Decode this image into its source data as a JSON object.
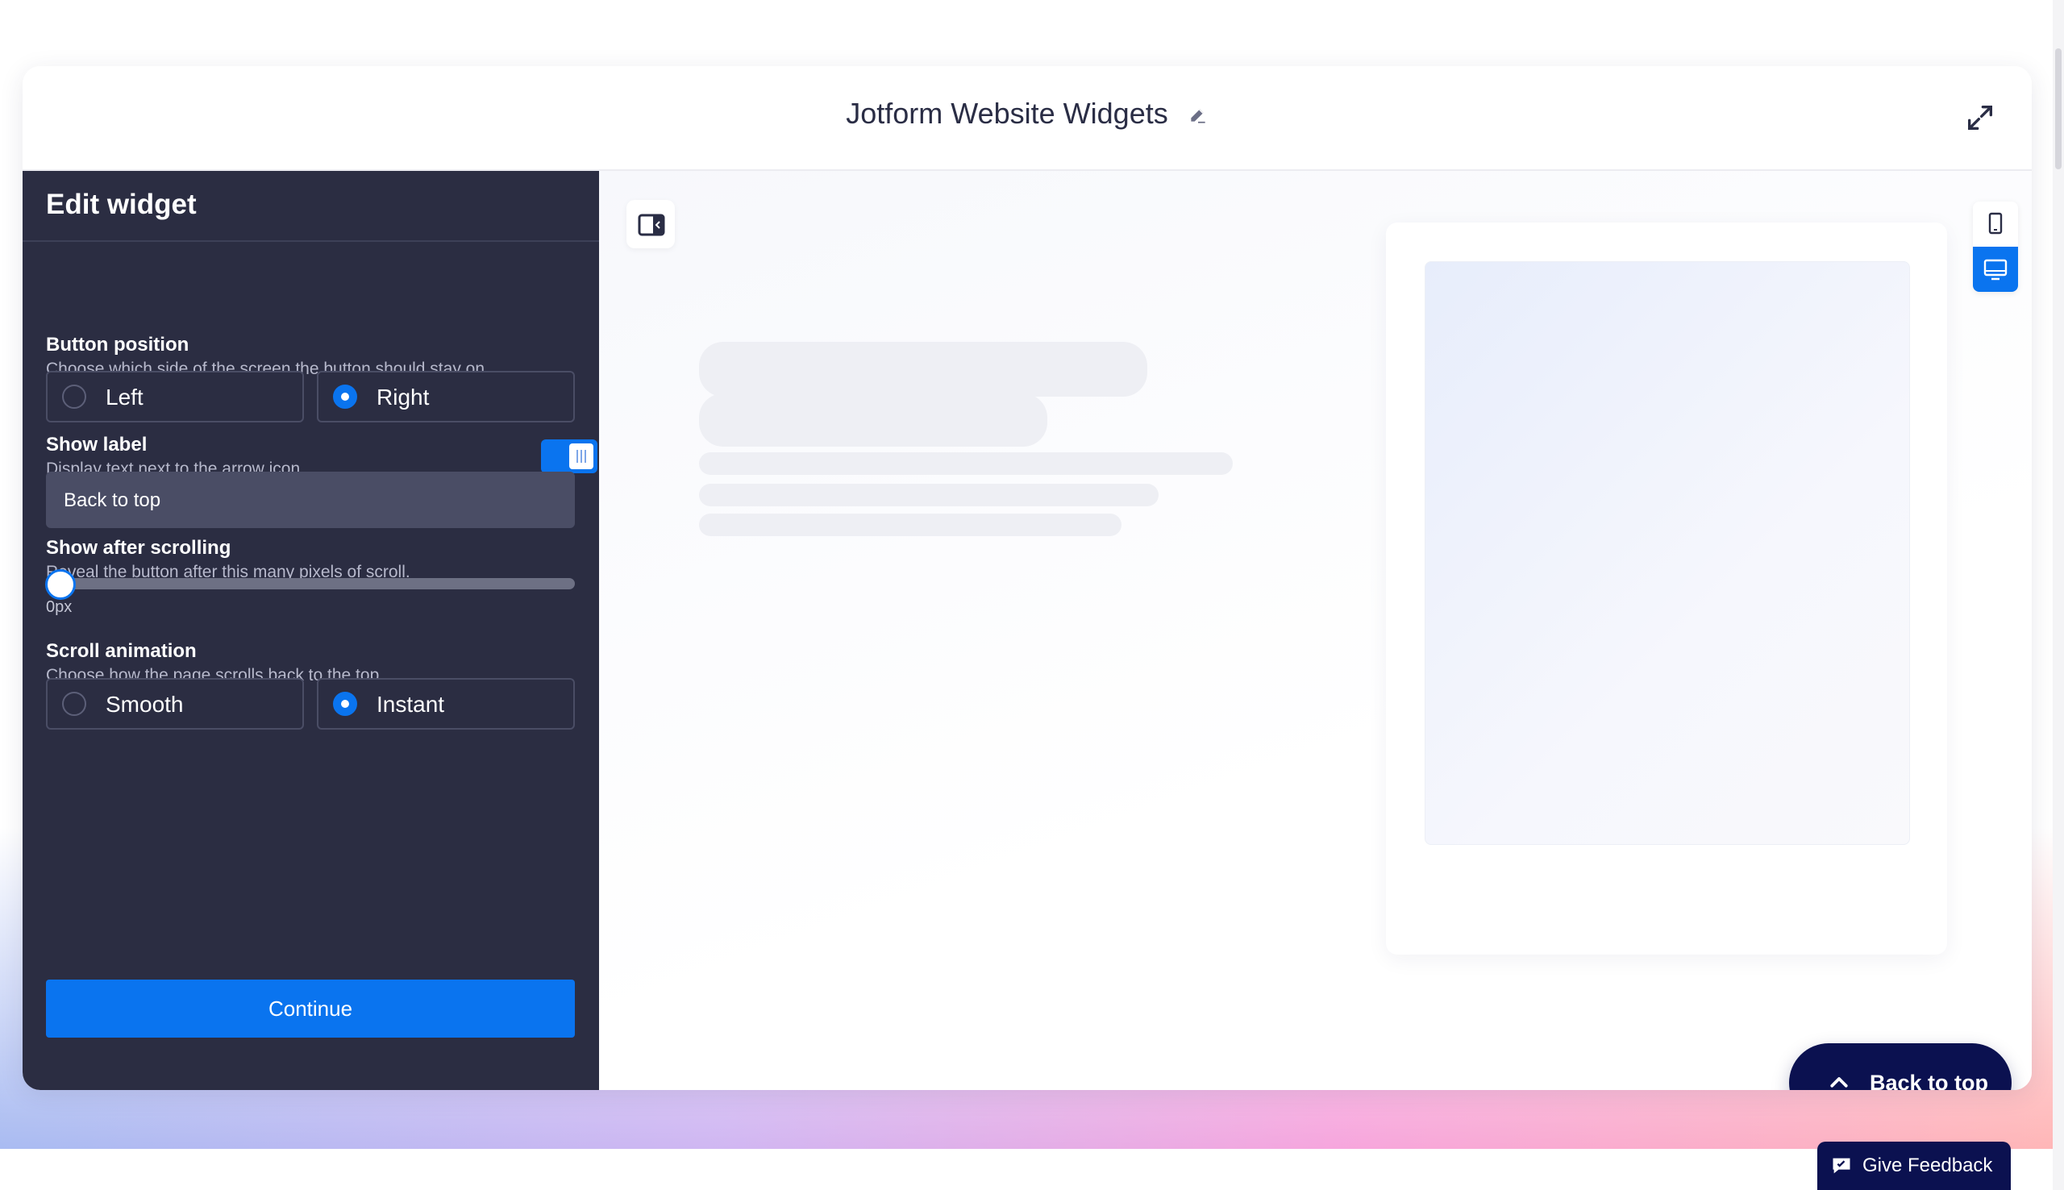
{
  "app": {
    "title": "Jotform Website Widgets"
  },
  "panel": {
    "title": "Edit widget",
    "button_position": {
      "title": "Button position",
      "description": "Choose which side of the screen the button should stay on.",
      "options": [
        {
          "label": "Left",
          "selected": false
        },
        {
          "label": "Right",
          "selected": true
        }
      ]
    },
    "show_label": {
      "title": "Show label",
      "description": "Display text next to the arrow icon.",
      "enabled": true,
      "value": "Back to top"
    },
    "show_after_scrolling": {
      "title": "Show after scrolling",
      "description": "Reveal the button after this many pixels of scroll.",
      "value": "0px"
    },
    "scroll_animation": {
      "title": "Scroll animation",
      "description": "Choose how the page scrolls back to the top.",
      "options": [
        {
          "label": "Smooth",
          "selected": false
        },
        {
          "label": "Instant",
          "selected": true
        }
      ]
    },
    "continue_label": "Continue"
  },
  "preview": {
    "back_to_top_label": "Back to top"
  },
  "feedback": {
    "label": "Give Feedback"
  },
  "colors": {
    "accent": "#0a74ef",
    "panel_bg": "#2b2d42",
    "button_dark": "#0b1150"
  },
  "icons": {
    "edit": "pencil-icon",
    "expand": "expand-icon",
    "panel_toggle": "sidebar-toggle-icon",
    "mobile": "mobile-icon",
    "desktop": "desktop-icon",
    "chevron": "chevron-up-icon",
    "feedback": "feedback-icon"
  }
}
